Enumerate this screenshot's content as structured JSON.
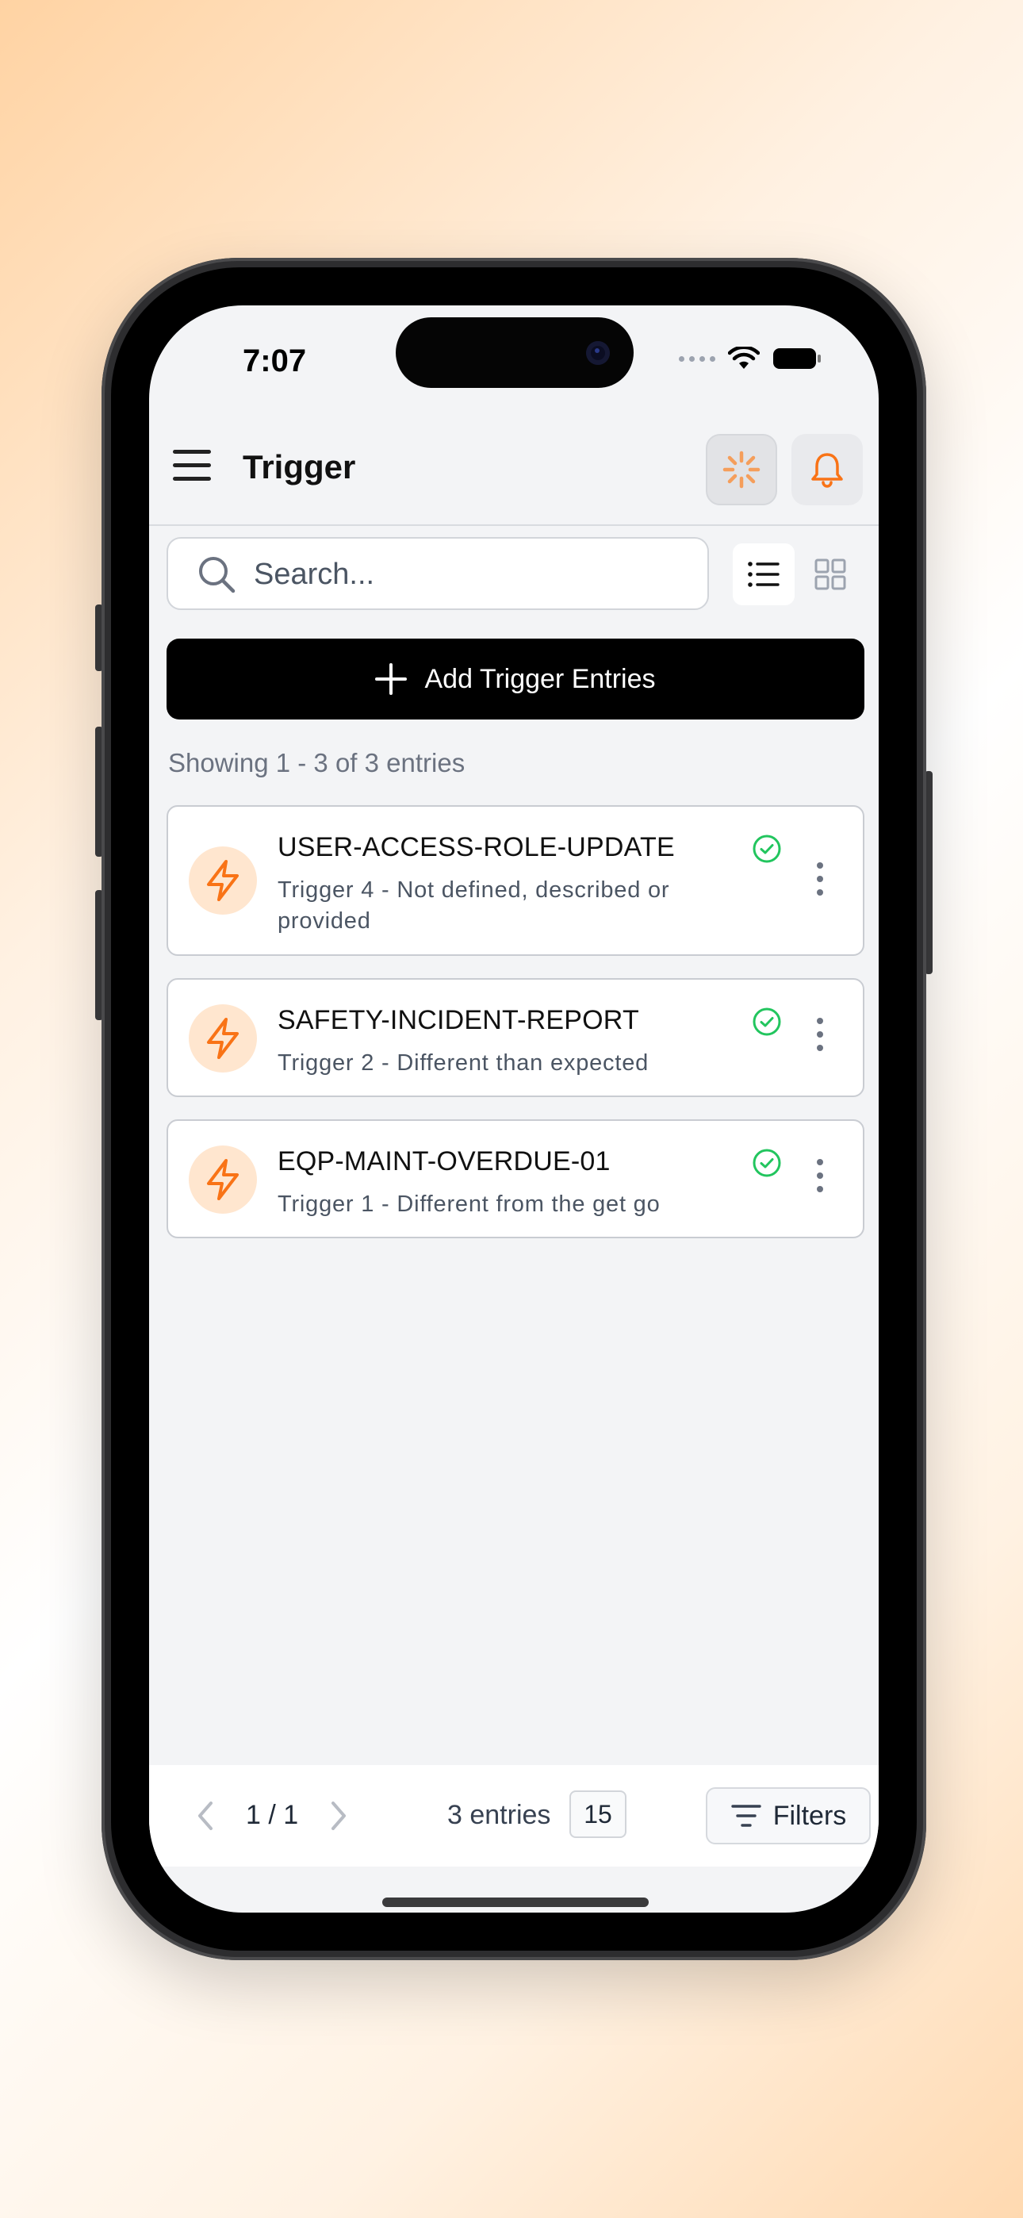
{
  "status_bar": {
    "time": "7:07"
  },
  "header": {
    "title": "Trigger"
  },
  "search": {
    "placeholder": "Search..."
  },
  "actions": {
    "add_label": "Add Trigger Entries"
  },
  "summary": {
    "showing": "Showing 1 - 3 of 3 entries"
  },
  "entries": [
    {
      "title": "USER-ACCESS-ROLE-UPDATE",
      "subtitle": "Trigger 4 - Not defined, described or provided",
      "status": "active"
    },
    {
      "title": "SAFETY-INCIDENT-REPORT",
      "subtitle": "Trigger 2 - Different than expected",
      "status": "active"
    },
    {
      "title": "EQP-MAINT-OVERDUE-01",
      "subtitle": "Trigger 1 - Different from the get go",
      "status": "active"
    }
  ],
  "pagination": {
    "page": "1 / 1",
    "entries": "3 entries",
    "per_page": "15",
    "filters_label": "Filters"
  },
  "colors": {
    "accent": "#f97316",
    "success": "#22c55e",
    "primary_button": "#000000",
    "background": "#f3f4f6"
  },
  "icons": [
    "hamburger-icon",
    "loader-icon",
    "bell-icon",
    "search-icon",
    "list-view-icon",
    "grid-view-icon",
    "plus-icon",
    "lightning-icon",
    "check-circle-icon",
    "more-vertical-icon",
    "chevron-left-icon",
    "chevron-right-icon",
    "filter-icon"
  ]
}
